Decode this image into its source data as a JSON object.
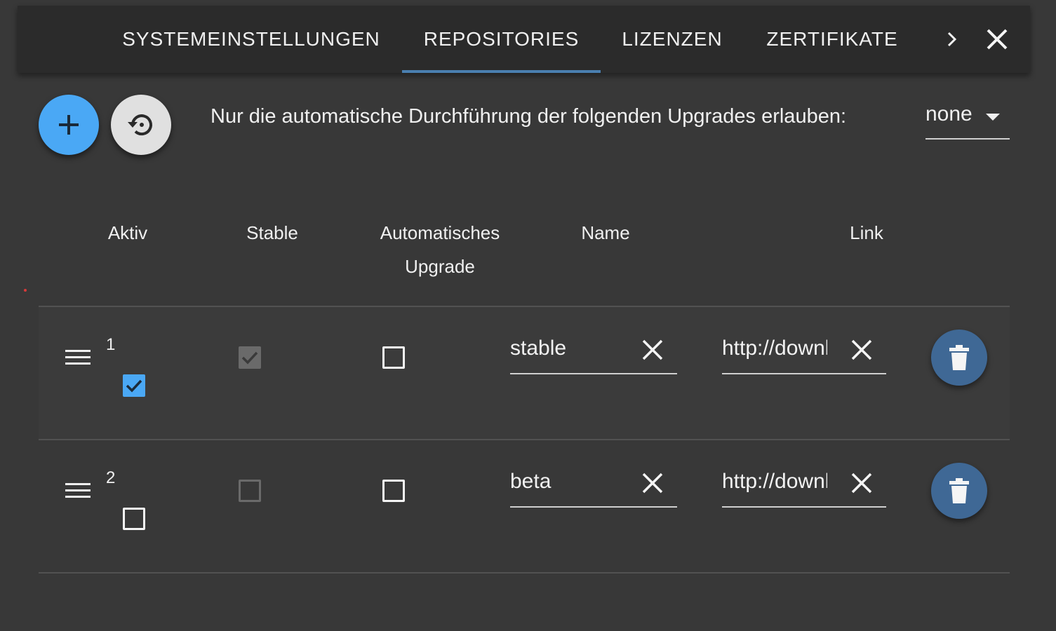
{
  "tabs": [
    {
      "label": "SYSTEMEINSTELLUNGEN",
      "active": false
    },
    {
      "label": "REPOSITORIES",
      "active": true
    },
    {
      "label": "LIZENZEN",
      "active": false
    },
    {
      "label": "ZERTIFIKATE",
      "active": false
    }
  ],
  "upgrade_label": "Nur die automatische Durchführung der folgenden Upgrades erlauben:",
  "upgrade_select": {
    "value": "none"
  },
  "table": {
    "headers": {
      "active": "Aktiv",
      "stable": "Stable",
      "auto_upgrade": "Automatisches Upgrade",
      "name": "Name",
      "link": "Link"
    },
    "rows": [
      {
        "index": "1",
        "active": true,
        "stable": true,
        "auto_upgrade": false,
        "name": "stable",
        "link": "http://download.iobroker.net/sources-dist.json"
      },
      {
        "index": "2",
        "active": false,
        "stable": false,
        "auto_upgrade": false,
        "name": "beta",
        "link": "http://download.iobroker.net/sources-dist-latest.json"
      }
    ]
  },
  "icons": {
    "add": "plus-icon",
    "restore": "restore-icon",
    "scroll": "chevron-right-icon",
    "close": "close-icon",
    "drag": "drag-handle-icon",
    "clear": "clear-icon",
    "delete": "trash-icon"
  },
  "colors": {
    "background": "#383838",
    "tabbar": "#2b2b2b",
    "accent": "#4aa8f5",
    "tab_indicator": "#4a7fb0",
    "delete_button": "#3f6895"
  }
}
